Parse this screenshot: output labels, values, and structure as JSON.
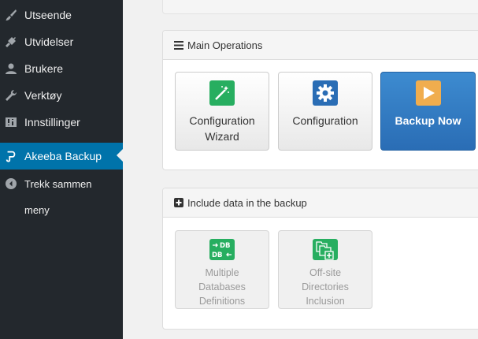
{
  "sidebar": {
    "items": [
      {
        "label": "Utseende",
        "icon": "brush-icon"
      },
      {
        "label": "Utvidelser",
        "icon": "plugin-icon"
      },
      {
        "label": "Brukere",
        "icon": "user-icon"
      },
      {
        "label": "Verktøy",
        "icon": "wrench-icon"
      },
      {
        "label": "Innstillinger",
        "icon": "settings-icon"
      },
      {
        "label": "Akeeba Backup",
        "icon": "akeeba-icon"
      }
    ],
    "collapse_label_line1": "Trekk sammen",
    "collapse_label_line2": "meny"
  },
  "main_operations": {
    "title": "Main Operations",
    "buttons": [
      {
        "label_line1": "Configuration",
        "label_line2": "Wizard"
      },
      {
        "label_line1": "Configuration"
      },
      {
        "label_line1": "Backup Now"
      }
    ]
  },
  "include_data": {
    "title": "Include data in the backup",
    "buttons": [
      {
        "label_line1": "Multiple",
        "label_line2": "Databases",
        "label_line3": "Definitions"
      },
      {
        "label_line1": "Off-site",
        "label_line2": "Directories",
        "label_line3": "Inclusion"
      }
    ]
  },
  "colors": {
    "sidebar_bg": "#23282d",
    "active_bg": "#0073aa",
    "primary_button": "#2a6db5",
    "green_icon": "#27ae60"
  }
}
